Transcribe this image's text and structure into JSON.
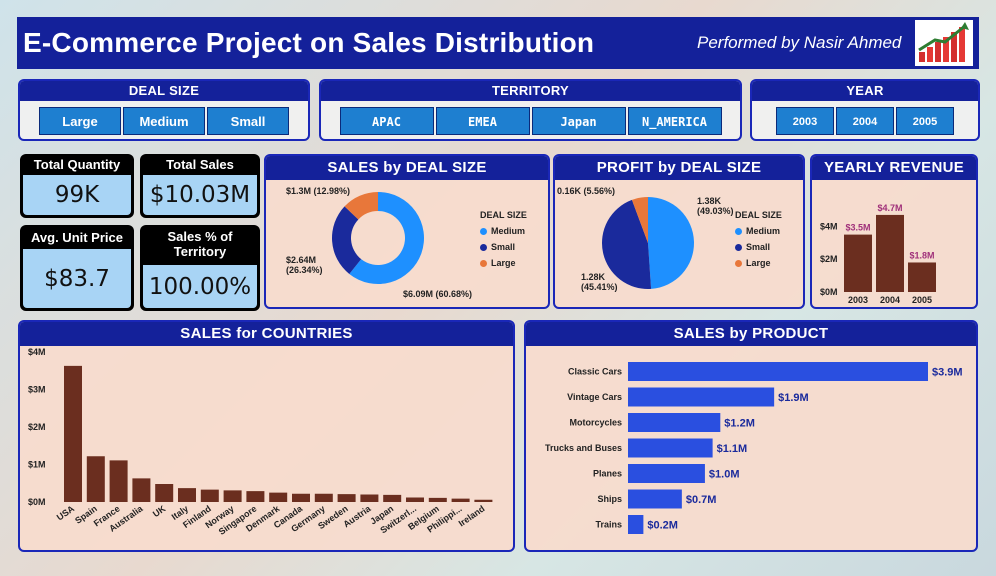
{
  "header": {
    "title": "E-Commerce Project on Sales Distribution",
    "subtitle": "Performed by Nasir Ahmed",
    "logo_icon": "growth-chart-icon"
  },
  "slicers": {
    "deal_size": {
      "title": "DEAL SIZE",
      "options": [
        "Large",
        "Medium",
        "Small"
      ]
    },
    "territory": {
      "title": "TERRITORY",
      "options": [
        "APAC",
        "EMEA",
        "Japan",
        "N_AMERICA"
      ]
    },
    "year": {
      "title": "YEAR",
      "options": [
        "2003",
        "2004",
        "2005"
      ]
    }
  },
  "kpis": {
    "total_quantity": {
      "label": "Total Quantity",
      "value": "99K"
    },
    "total_sales": {
      "label": "Total Sales",
      "value": "$10.03M"
    },
    "avg_unit_price": {
      "label": "Avg. Unit Price",
      "value": "$83.7"
    },
    "sales_pct": {
      "label": "Sales % of Territory",
      "value": "100.00%"
    }
  },
  "colors": {
    "header": "#14219a",
    "medium": "#1e90ff",
    "small": "#1a2a9c",
    "large": "#e8773a",
    "bar_brown": "#6b2e1f",
    "bar_blue": "#2a4fe0",
    "value_purple": "#a0307a"
  },
  "chart_data": [
    {
      "id": "sales_by_deal_size",
      "type": "pie",
      "title": "SALES by DEAL SIZE",
      "legend_title": "DEAL SIZE",
      "slices": [
        {
          "name": "Medium",
          "value": 6.09,
          "label": "$6.09M (60.68%)"
        },
        {
          "name": "Small",
          "value": 2.64,
          "label": "$2.64M (26.34%)"
        },
        {
          "name": "Large",
          "value": 1.3,
          "label": "$1.3M (12.98%)"
        }
      ]
    },
    {
      "id": "profit_by_deal_size",
      "type": "pie",
      "title": "PROFIT by DEAL SIZE",
      "legend_title": "DEAL SIZE",
      "slices": [
        {
          "name": "Medium",
          "value": 1.38,
          "label": "1.38K (49.03%)"
        },
        {
          "name": "Small",
          "value": 1.28,
          "label": "1.28K (45.41%)"
        },
        {
          "name": "Large",
          "value": 0.16,
          "label": "0.16K (5.56%)"
        }
      ]
    },
    {
      "id": "yearly_revenue",
      "type": "bar",
      "title": "YEARLY REVENUE",
      "categories": [
        "2003",
        "2004",
        "2005"
      ],
      "values": [
        3.5,
        4.7,
        1.8
      ],
      "data_labels": [
        "$3.5M",
        "$4.7M",
        "$1.8M"
      ],
      "yticks": [
        "$0M",
        "$2M",
        "$4M"
      ],
      "ylim": [
        0,
        5
      ]
    },
    {
      "id": "sales_for_countries",
      "type": "bar",
      "title": "SALES for COUNTRIES",
      "categories": [
        "USA",
        "Spain",
        "France",
        "Australia",
        "UK",
        "Italy",
        "Finland",
        "Norway",
        "Singapore",
        "Denmark",
        "Canada",
        "Germany",
        "Sweden",
        "Austria",
        "Japan",
        "Switzerl...",
        "Belgium",
        "Philippi...",
        "Ireland"
      ],
      "values": [
        3.63,
        1.22,
        1.11,
        0.63,
        0.48,
        0.37,
        0.33,
        0.31,
        0.29,
        0.25,
        0.22,
        0.22,
        0.21,
        0.2,
        0.19,
        0.12,
        0.11,
        0.09,
        0.06
      ],
      "yticks": [
        "$0M",
        "$1M",
        "$2M",
        "$3M",
        "$4M"
      ],
      "ylim": [
        0,
        4
      ]
    },
    {
      "id": "sales_by_product",
      "type": "bar",
      "orientation": "horizontal",
      "title": "SALES by PRODUCT",
      "categories": [
        "Classic Cars",
        "Vintage Cars",
        "Motorcycles",
        "Trucks and Buses",
        "Planes",
        "Ships",
        "Trains"
      ],
      "values": [
        3.9,
        1.9,
        1.2,
        1.1,
        1.0,
        0.7,
        0.2
      ],
      "data_labels": [
        "$3.9M",
        "$1.9M",
        "$1.2M",
        "$1.1M",
        "$1.0M",
        "$0.7M",
        "$0.2M"
      ]
    }
  ]
}
